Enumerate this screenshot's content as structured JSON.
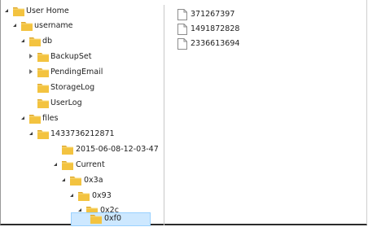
{
  "tree": [
    {
      "label": "User Home",
      "expanded": true
    },
    {
      "label": "username",
      "expanded": true
    },
    {
      "label": "db",
      "expanded": true
    },
    {
      "label": "BackupSet",
      "expanded": false
    },
    {
      "label": "PendingEmail",
      "expanded": false
    },
    {
      "label": "StorageLog"
    },
    {
      "label": "UserLog"
    },
    {
      "label": "files",
      "expanded": true
    },
    {
      "label": "1433736212871",
      "expanded": true
    },
    {
      "label": "2015-06-08-12-03-47"
    },
    {
      "label": "Current",
      "expanded": true
    },
    {
      "label": "0x3a",
      "expanded": true
    },
    {
      "label": "0x93",
      "expanded": true
    },
    {
      "label": "0x2c",
      "expanded": true
    },
    {
      "label": "0xf0",
      "selected": true
    }
  ],
  "files": [
    {
      "name": "371267397",
      "icon": "file-icon"
    },
    {
      "name": "1491872828",
      "icon": "file-icon"
    },
    {
      "name": "2336613694",
      "icon": "file-icon"
    }
  ],
  "colors": {
    "selection_fill": "#cde8ff",
    "selection_border": "#99d1ff",
    "folder_yellow": "#f3c340"
  }
}
